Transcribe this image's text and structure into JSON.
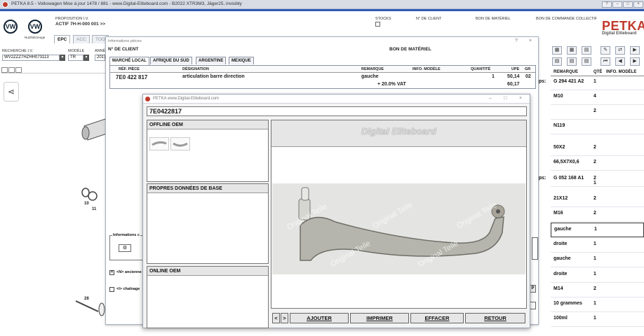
{
  "app": {
    "title": "PETKA 8.5 - Volkswagen Mise à jour 1478 / 881 - www.Digital-Eliteboard.com - B2022 XTR3M3, Jäger25, invisibly",
    "logo_text": "PETKA",
    "logo_sub": "Digital Eliteboard",
    "window_controls": [
      "?",
      "–",
      "□",
      "×"
    ]
  },
  "header": {
    "brand_label": "Nutzfahrzeuge",
    "proposition_label": "PROPOSITION I.V.",
    "proposition_value": "ACTIF  7H-H-000 001 >>",
    "stocks_label": "STOCKS",
    "client_label": "N° DE CLIENT",
    "bon_label": "BON DE MATÉRIEL",
    "bon_collectif_label": "BON DE COMMANDE COLLECTIF",
    "tabs": [
      "EPC",
      "ACC",
      "TOO"
    ],
    "recherche_label": "RECHERCHE I.V.",
    "recherche_value": "WV2ZZZ7HZHH073113",
    "modele_label": "MODÈLE",
    "modele_value": "TR",
    "annee_label": "ANNÉE",
    "annee_value": "2017"
  },
  "diagram": {
    "callouts": [
      "10",
      "11",
      "28"
    ]
  },
  "right_panel": {
    "columns": [
      "REMARQUE",
      "QTÉ",
      "INFO. MODÈLE"
    ],
    "rows": [
      {
        "pre": "aps:",
        "remarque": "G  294 421 A2",
        "qte": "1"
      },
      {
        "pre": "",
        "remarque": "M10",
        "qte": "4"
      },
      {
        "pre": "",
        "remarque": "",
        "qte": "2"
      },
      {
        "pre": "",
        "remarque": "N119",
        "qte": ""
      },
      {
        "pre": "",
        "remarque": "50X2",
        "qte": "2"
      },
      {
        "pre": "",
        "remarque": "66,5X7X0,6",
        "qte": "2"
      },
      {
        "pre": "aps:",
        "remarque": "G  052 168 A1",
        "qte": "2\n1"
      },
      {
        "pre": "",
        "remarque": "21X12",
        "qte": "2"
      },
      {
        "pre": "",
        "remarque": "M16",
        "qte": "2"
      },
      {
        "pre": "",
        "remarque": "gauche",
        "qte": "1"
      },
      {
        "pre": "",
        "remarque": "droite",
        "qte": "1"
      },
      {
        "pre": "",
        "remarque": "gauche",
        "qte": "1"
      },
      {
        "pre": "",
        "remarque": "droite",
        "qte": "1"
      },
      {
        "pre": "",
        "remarque": "M14",
        "qte": "2"
      },
      {
        "pre": "",
        "remarque": "10 grammes",
        "qte": "1"
      },
      {
        "pre": "",
        "remarque": "100ml",
        "qte": "1"
      }
    ]
  },
  "info_window": {
    "title": "Informations pièces",
    "client_label": "N° DE CLIENT",
    "bon_label": "BON DE MATÉRIEL",
    "tabs": [
      "MARCHÉ LOCAL",
      "AFRIQUE DU SUD",
      "ARGENTINE",
      "MEXIQUE"
    ],
    "columns": [
      "RÉF. PIÈCE",
      "DÉSIGNATION",
      "REMARQUE",
      "INFO. MODÈLE",
      "QUANTITÉ",
      "UPE",
      "GR"
    ],
    "row": {
      "ref": "7E0 422 817",
      "designation": "articulation barre direction",
      "remarque": "gauche",
      "vat_label": "+ 20.0% VAT",
      "quantite": "1",
      "upe": "50,14",
      "gr": "02",
      "upe_vat": "60,17"
    },
    "info_group_label": "Informations c",
    "check1_label": "<N> ancienne",
    "check2_label": "<I> chaînage",
    "check1_checked": true,
    "check2_checked": false,
    "p_label": "P"
  },
  "de_window": {
    "title": "PETKA www.Digital-Eliteboard.com",
    "part_code": "7E0422817",
    "panel_offline": "OFFLINE OEM",
    "panel_base": "PROPRES DONNÉES DE BASE",
    "panel_online": "ONLINE OEM",
    "brand_banner": "Digital Eliteboard",
    "watermark": "Original Teile",
    "buttons": {
      "prev": "<",
      "next": ">",
      "ajouter": "AJOUTER",
      "imprimer": "IMPRIMER",
      "effacer": "EFFACER",
      "retour": "RETOUR"
    }
  },
  "colors": {
    "accent_blue": "#2f5bb7",
    "brand_red": "#c0392b"
  }
}
